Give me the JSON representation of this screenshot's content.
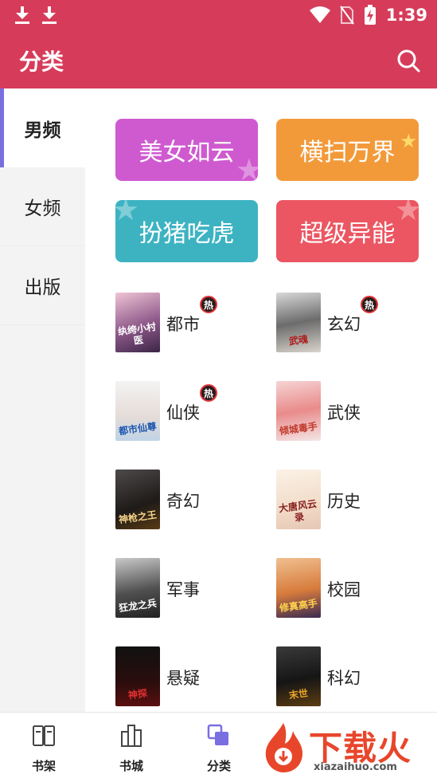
{
  "status_bar": {
    "time": "1:39"
  },
  "app_bar": {
    "title": "分类",
    "search_icon": "search-icon"
  },
  "sidebar": {
    "items": [
      {
        "label": "男频",
        "active": true
      },
      {
        "label": "女频",
        "active": false
      },
      {
        "label": "出版",
        "active": false
      }
    ]
  },
  "banners": [
    {
      "label": "美女如云",
      "color": "#cf5ad0"
    },
    {
      "label": "横扫万界",
      "color": "#f29a3a"
    },
    {
      "label": "扮猪吃虎",
      "color": "#3db3c2"
    },
    {
      "label": "超级异能",
      "color": "#eb5662"
    }
  ],
  "hot_badge": "热",
  "categories": [
    {
      "label": "都市",
      "hot": true,
      "cover_text": "纨绔小村医"
    },
    {
      "label": "玄幻",
      "hot": true,
      "cover_text": "武魂"
    },
    {
      "label": "仙侠",
      "hot": true,
      "cover_text": "都市仙尊"
    },
    {
      "label": "武侠",
      "hot": false,
      "cover_text": "倾城毒手"
    },
    {
      "label": "奇幻",
      "hot": false,
      "cover_text": "神枪之王"
    },
    {
      "label": "历史",
      "hot": false,
      "cover_text": "大唐风云录"
    },
    {
      "label": "军事",
      "hot": false,
      "cover_text": "狂龙之兵"
    },
    {
      "label": "校园",
      "hot": false,
      "cover_text": "修真高手"
    },
    {
      "label": "悬疑",
      "hot": false,
      "cover_text": "神探"
    },
    {
      "label": "科幻",
      "hot": false,
      "cover_text": "末世"
    }
  ],
  "bottom_nav": [
    {
      "label": "书架",
      "icon": "bookshelf-icon"
    },
    {
      "label": "书城",
      "icon": "bookstore-icon"
    },
    {
      "label": "分类",
      "icon": "category-icon"
    }
  ],
  "watermark": {
    "text": "下载火",
    "url": "xiazaihuo.com"
  },
  "colors": {
    "brand": "#d63c5a",
    "accent": "#7a6fe0",
    "hot": "#e0353a"
  }
}
